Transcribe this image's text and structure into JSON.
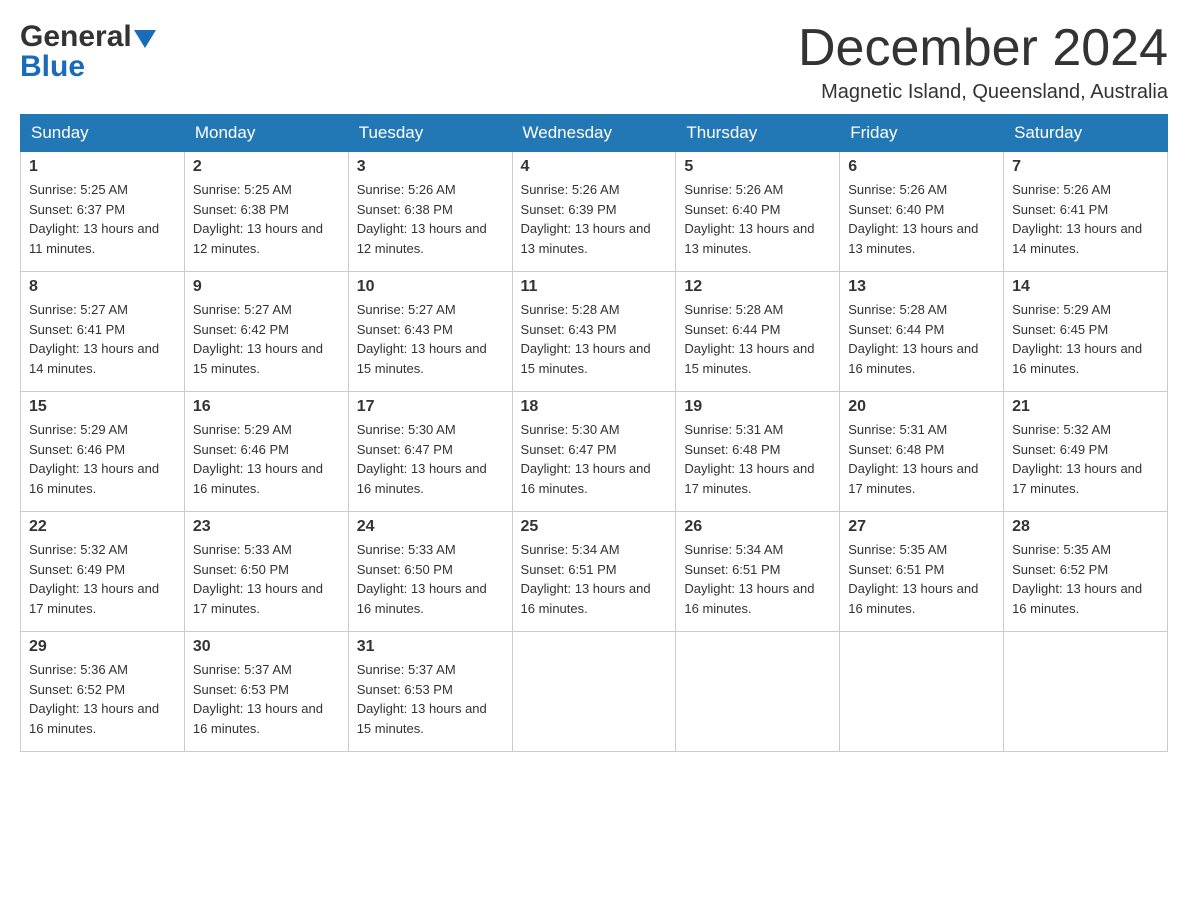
{
  "header": {
    "logo": {
      "text_general": "General",
      "text_blue": "Blue",
      "arrow_color": "#1a6bba"
    },
    "title": "December 2024",
    "location": "Magnetic Island, Queensland, Australia"
  },
  "weekdays": [
    "Sunday",
    "Monday",
    "Tuesday",
    "Wednesday",
    "Thursday",
    "Friday",
    "Saturday"
  ],
  "weeks": [
    [
      {
        "day": "1",
        "sunrise": "5:25 AM",
        "sunset": "6:37 PM",
        "daylight": "13 hours and 11 minutes."
      },
      {
        "day": "2",
        "sunrise": "5:25 AM",
        "sunset": "6:38 PM",
        "daylight": "13 hours and 12 minutes."
      },
      {
        "day": "3",
        "sunrise": "5:26 AM",
        "sunset": "6:38 PM",
        "daylight": "13 hours and 12 minutes."
      },
      {
        "day": "4",
        "sunrise": "5:26 AM",
        "sunset": "6:39 PM",
        "daylight": "13 hours and 13 minutes."
      },
      {
        "day": "5",
        "sunrise": "5:26 AM",
        "sunset": "6:40 PM",
        "daylight": "13 hours and 13 minutes."
      },
      {
        "day": "6",
        "sunrise": "5:26 AM",
        "sunset": "6:40 PM",
        "daylight": "13 hours and 13 minutes."
      },
      {
        "day": "7",
        "sunrise": "5:26 AM",
        "sunset": "6:41 PM",
        "daylight": "13 hours and 14 minutes."
      }
    ],
    [
      {
        "day": "8",
        "sunrise": "5:27 AM",
        "sunset": "6:41 PM",
        "daylight": "13 hours and 14 minutes."
      },
      {
        "day": "9",
        "sunrise": "5:27 AM",
        "sunset": "6:42 PM",
        "daylight": "13 hours and 15 minutes."
      },
      {
        "day": "10",
        "sunrise": "5:27 AM",
        "sunset": "6:43 PM",
        "daylight": "13 hours and 15 minutes."
      },
      {
        "day": "11",
        "sunrise": "5:28 AM",
        "sunset": "6:43 PM",
        "daylight": "13 hours and 15 minutes."
      },
      {
        "day": "12",
        "sunrise": "5:28 AM",
        "sunset": "6:44 PM",
        "daylight": "13 hours and 15 minutes."
      },
      {
        "day": "13",
        "sunrise": "5:28 AM",
        "sunset": "6:44 PM",
        "daylight": "13 hours and 16 minutes."
      },
      {
        "day": "14",
        "sunrise": "5:29 AM",
        "sunset": "6:45 PM",
        "daylight": "13 hours and 16 minutes."
      }
    ],
    [
      {
        "day": "15",
        "sunrise": "5:29 AM",
        "sunset": "6:46 PM",
        "daylight": "13 hours and 16 minutes."
      },
      {
        "day": "16",
        "sunrise": "5:29 AM",
        "sunset": "6:46 PM",
        "daylight": "13 hours and 16 minutes."
      },
      {
        "day": "17",
        "sunrise": "5:30 AM",
        "sunset": "6:47 PM",
        "daylight": "13 hours and 16 minutes."
      },
      {
        "day": "18",
        "sunrise": "5:30 AM",
        "sunset": "6:47 PM",
        "daylight": "13 hours and 16 minutes."
      },
      {
        "day": "19",
        "sunrise": "5:31 AM",
        "sunset": "6:48 PM",
        "daylight": "13 hours and 17 minutes."
      },
      {
        "day": "20",
        "sunrise": "5:31 AM",
        "sunset": "6:48 PM",
        "daylight": "13 hours and 17 minutes."
      },
      {
        "day": "21",
        "sunrise": "5:32 AM",
        "sunset": "6:49 PM",
        "daylight": "13 hours and 17 minutes."
      }
    ],
    [
      {
        "day": "22",
        "sunrise": "5:32 AM",
        "sunset": "6:49 PM",
        "daylight": "13 hours and 17 minutes."
      },
      {
        "day": "23",
        "sunrise": "5:33 AM",
        "sunset": "6:50 PM",
        "daylight": "13 hours and 17 minutes."
      },
      {
        "day": "24",
        "sunrise": "5:33 AM",
        "sunset": "6:50 PM",
        "daylight": "13 hours and 16 minutes."
      },
      {
        "day": "25",
        "sunrise": "5:34 AM",
        "sunset": "6:51 PM",
        "daylight": "13 hours and 16 minutes."
      },
      {
        "day": "26",
        "sunrise": "5:34 AM",
        "sunset": "6:51 PM",
        "daylight": "13 hours and 16 minutes."
      },
      {
        "day": "27",
        "sunrise": "5:35 AM",
        "sunset": "6:51 PM",
        "daylight": "13 hours and 16 minutes."
      },
      {
        "day": "28",
        "sunrise": "5:35 AM",
        "sunset": "6:52 PM",
        "daylight": "13 hours and 16 minutes."
      }
    ],
    [
      {
        "day": "29",
        "sunrise": "5:36 AM",
        "sunset": "6:52 PM",
        "daylight": "13 hours and 16 minutes."
      },
      {
        "day": "30",
        "sunrise": "5:37 AM",
        "sunset": "6:53 PM",
        "daylight": "13 hours and 16 minutes."
      },
      {
        "day": "31",
        "sunrise": "5:37 AM",
        "sunset": "6:53 PM",
        "daylight": "13 hours and 15 minutes."
      },
      null,
      null,
      null,
      null
    ]
  ],
  "labels": {
    "sunrise": "Sunrise:",
    "sunset": "Sunset:",
    "daylight": "Daylight:"
  }
}
